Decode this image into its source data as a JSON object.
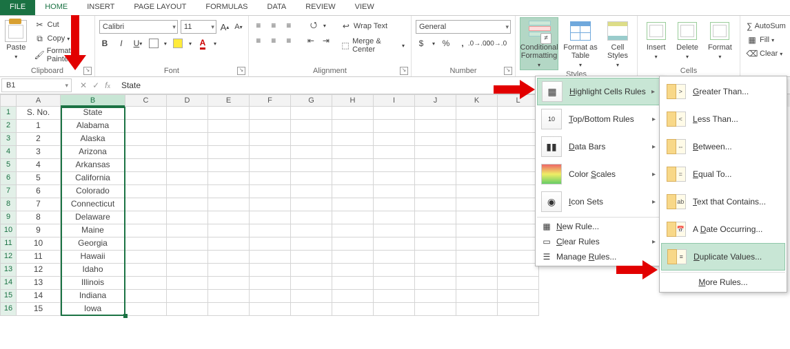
{
  "tabs": {
    "file": "FILE",
    "home": "HOME",
    "insert": "INSERT",
    "pagelayout": "PAGE LAYOUT",
    "formulas": "FORMULAS",
    "data": "DATA",
    "review": "REVIEW",
    "view": "VIEW"
  },
  "ribbon": {
    "clipboard": {
      "label": "Clipboard",
      "paste": "Paste",
      "cut": "Cut",
      "copy": "Copy",
      "fmtpainter": "Format Painter"
    },
    "font": {
      "label": "Font",
      "name": "Calibri",
      "size": "11"
    },
    "alignment": {
      "label": "Alignment",
      "wrap": "Wrap Text",
      "merge": "Merge & Center"
    },
    "number": {
      "label": "Number",
      "format": "General"
    },
    "styles": {
      "label": "Styles",
      "cf": "Conditional Formatting",
      "fat": "Format as Table",
      "cs": "Cell Styles"
    },
    "cells": {
      "label": "Cells",
      "insert": "Insert",
      "delete": "Delete",
      "format": "Format"
    },
    "editing": {
      "autosum": "AutoSum",
      "fill": "Fill",
      "clear": "Clear"
    }
  },
  "fbar": {
    "name": "B1",
    "formula": "State"
  },
  "cols": [
    "A",
    "B",
    "C",
    "D",
    "E",
    "F",
    "G",
    "H",
    "I",
    "J",
    "K",
    "L"
  ],
  "headerRow": {
    "a": "S. No.",
    "b": "State"
  },
  "rows": [
    {
      "n": "1",
      "a": "1",
      "b": "Alabama"
    },
    {
      "n": "2",
      "a": "2",
      "b": "Alaska"
    },
    {
      "n": "3",
      "a": "3",
      "b": "Arizona"
    },
    {
      "n": "4",
      "a": "4",
      "b": "Arkansas"
    },
    {
      "n": "5",
      "a": "5",
      "b": "California"
    },
    {
      "n": "6",
      "a": "6",
      "b": "Colorado"
    },
    {
      "n": "7",
      "a": "7",
      "b": "Connecticut"
    },
    {
      "n": "8",
      "a": "8",
      "b": "Delaware"
    },
    {
      "n": "9",
      "a": "9",
      "b": "Maine"
    },
    {
      "n": "10",
      "a": "10",
      "b": "Georgia"
    },
    {
      "n": "11",
      "a": "11",
      "b": "Hawaii"
    },
    {
      "n": "12",
      "a": "12",
      "b": "Idaho"
    },
    {
      "n": "13",
      "a": "13",
      "b": "Illinois"
    },
    {
      "n": "14",
      "a": "14",
      "b": "Indiana"
    },
    {
      "n": "15",
      "a": "15",
      "b": "Iowa"
    }
  ],
  "cfmenu": {
    "hcr": "Highlight Cells Rules",
    "tbr": "Top/Bottom Rules",
    "db": "Data Bars",
    "cs": "Color Scales",
    "is": "Icon Sets",
    "new": "New Rule...",
    "clear": "Clear Rules",
    "manage": "Manage Rules..."
  },
  "cfsub": {
    "gt": "Greater Than...",
    "lt": "Less Than...",
    "bw": "Between...",
    "eq": "Equal To...",
    "tc": "Text that Contains...",
    "do": "A Date Occurring...",
    "dv": "Duplicate Values...",
    "more": "More Rules..."
  }
}
